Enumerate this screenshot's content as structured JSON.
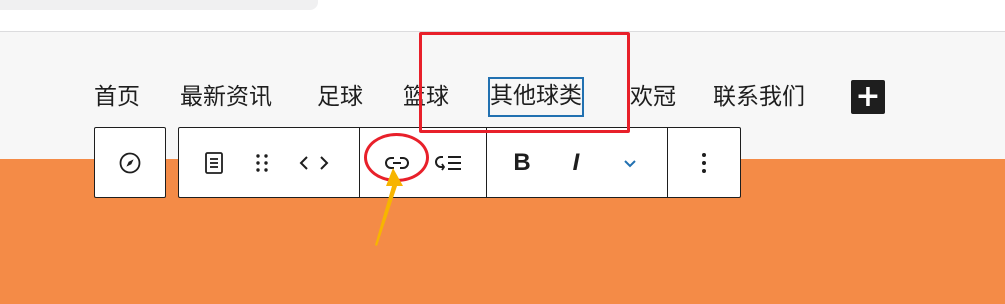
{
  "nav": {
    "items": [
      {
        "label": "首页"
      },
      {
        "label": "最新资讯"
      },
      {
        "label": "足球"
      },
      {
        "label": "篮球"
      },
      {
        "label": "其他球类"
      },
      {
        "label": "欢冠"
      },
      {
        "label": "联系我们"
      }
    ],
    "selected_index": 4,
    "add_block_symbol": "+"
  },
  "toolbar": {
    "bold_label": "B",
    "italic_label": "I",
    "icons": {
      "navigation": "compass-icon",
      "parent_block": "paragraph-block-icon",
      "drag": "drag-handle-icon",
      "move": "chevron-left-right-icon",
      "link": "link-icon",
      "submenu": "add-submenu-icon",
      "more_rich_text": "chevron-down-icon",
      "options": "more-vertical-icon"
    }
  },
  "colors": {
    "cover_background": "#f48b47",
    "header_background": "#f7f7f7",
    "selection_outline": "#2271b1",
    "annotation_red": "#e8202a",
    "annotation_arrow": "#f7b500",
    "dropdown_accent": "#2271b1"
  }
}
